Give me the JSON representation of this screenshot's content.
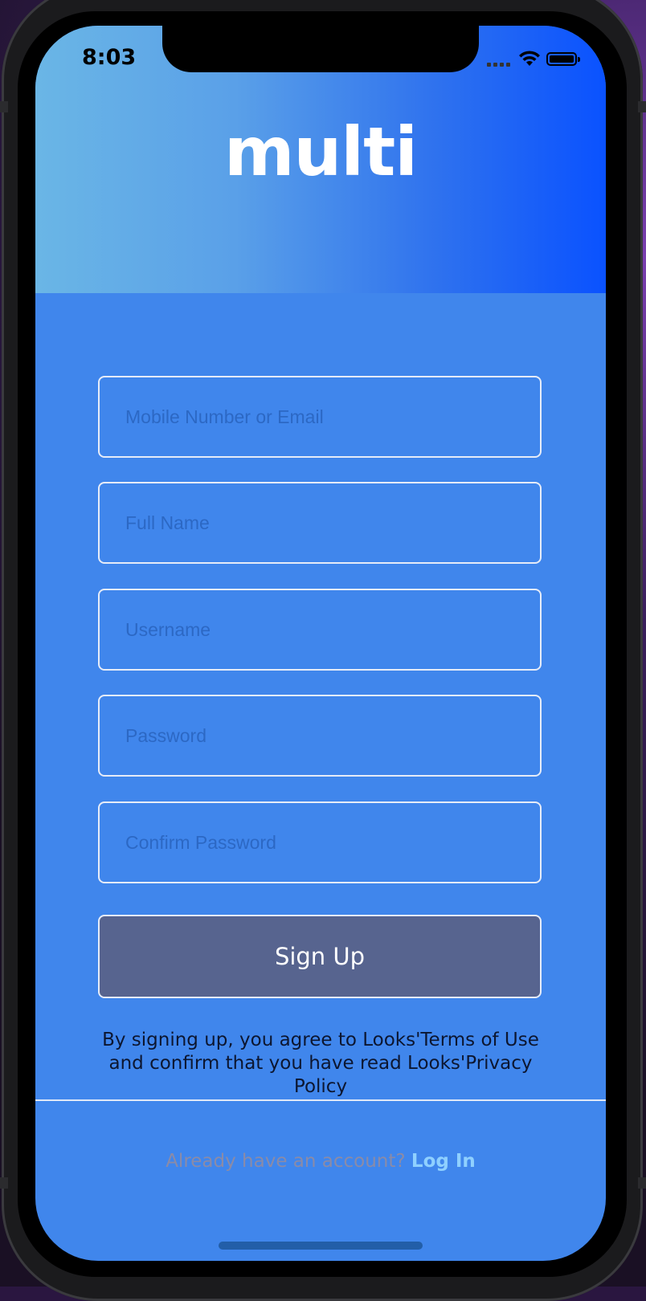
{
  "status_bar": {
    "time": "8:03"
  },
  "app": {
    "logo": "multi"
  },
  "form": {
    "fields": [
      {
        "placeholder": "Mobile Number or Email",
        "value": ""
      },
      {
        "placeholder": "Full Name",
        "value": ""
      },
      {
        "placeholder": "Username",
        "value": ""
      },
      {
        "placeholder": "Password",
        "value": ""
      },
      {
        "placeholder": "Confirm Password",
        "value": ""
      }
    ],
    "submit_label": "Sign Up",
    "terms_text": "By signing up, you agree to Looks'Terms of Use and confirm that you have read Looks'Privacy Policy"
  },
  "footer": {
    "prompt": "Already have an account?",
    "login_label": "Log In"
  },
  "colors": {
    "background": "#4086ec",
    "header_gradient_start": "#6ab6e6",
    "header_gradient_end": "#0a52ff",
    "button": "#57648f",
    "link": "#8fd0ff"
  }
}
